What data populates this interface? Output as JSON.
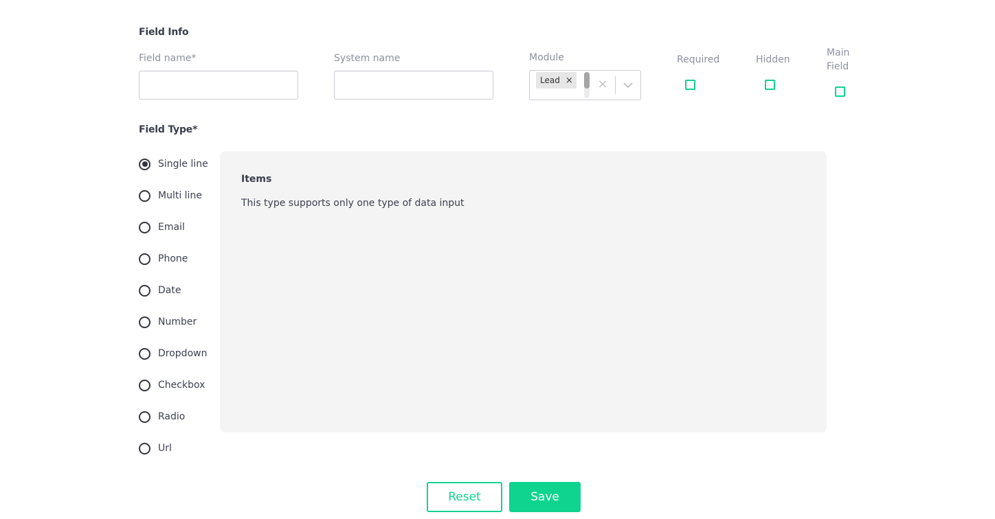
{
  "field_info": {
    "title": "Field Info",
    "field_name_label": "Field name*",
    "field_name_value": "",
    "system_name_label": "System name",
    "system_name_value": "",
    "module_label": "Module",
    "module_selected": [
      "Lead"
    ],
    "required_label": "Required",
    "hidden_label": "Hidden",
    "main_field_label_1": "Main",
    "main_field_label_2": "Field"
  },
  "field_type": {
    "title": "Field Type*",
    "selected": "Single line",
    "options": [
      "Single line",
      "Multi line",
      "Email",
      "Phone",
      "Date",
      "Number",
      "Dropdown",
      "Checkbox",
      "Radio",
      "Url"
    ]
  },
  "info_panel": {
    "title": "Items",
    "description": "This type supports only one type of data input"
  },
  "actions": {
    "reset_label": "Reset",
    "save_label": "Save"
  },
  "colors": {
    "accent": "#0ed490",
    "checkbox_border": "#11d192",
    "panel_bg": "#f4f4f5"
  }
}
